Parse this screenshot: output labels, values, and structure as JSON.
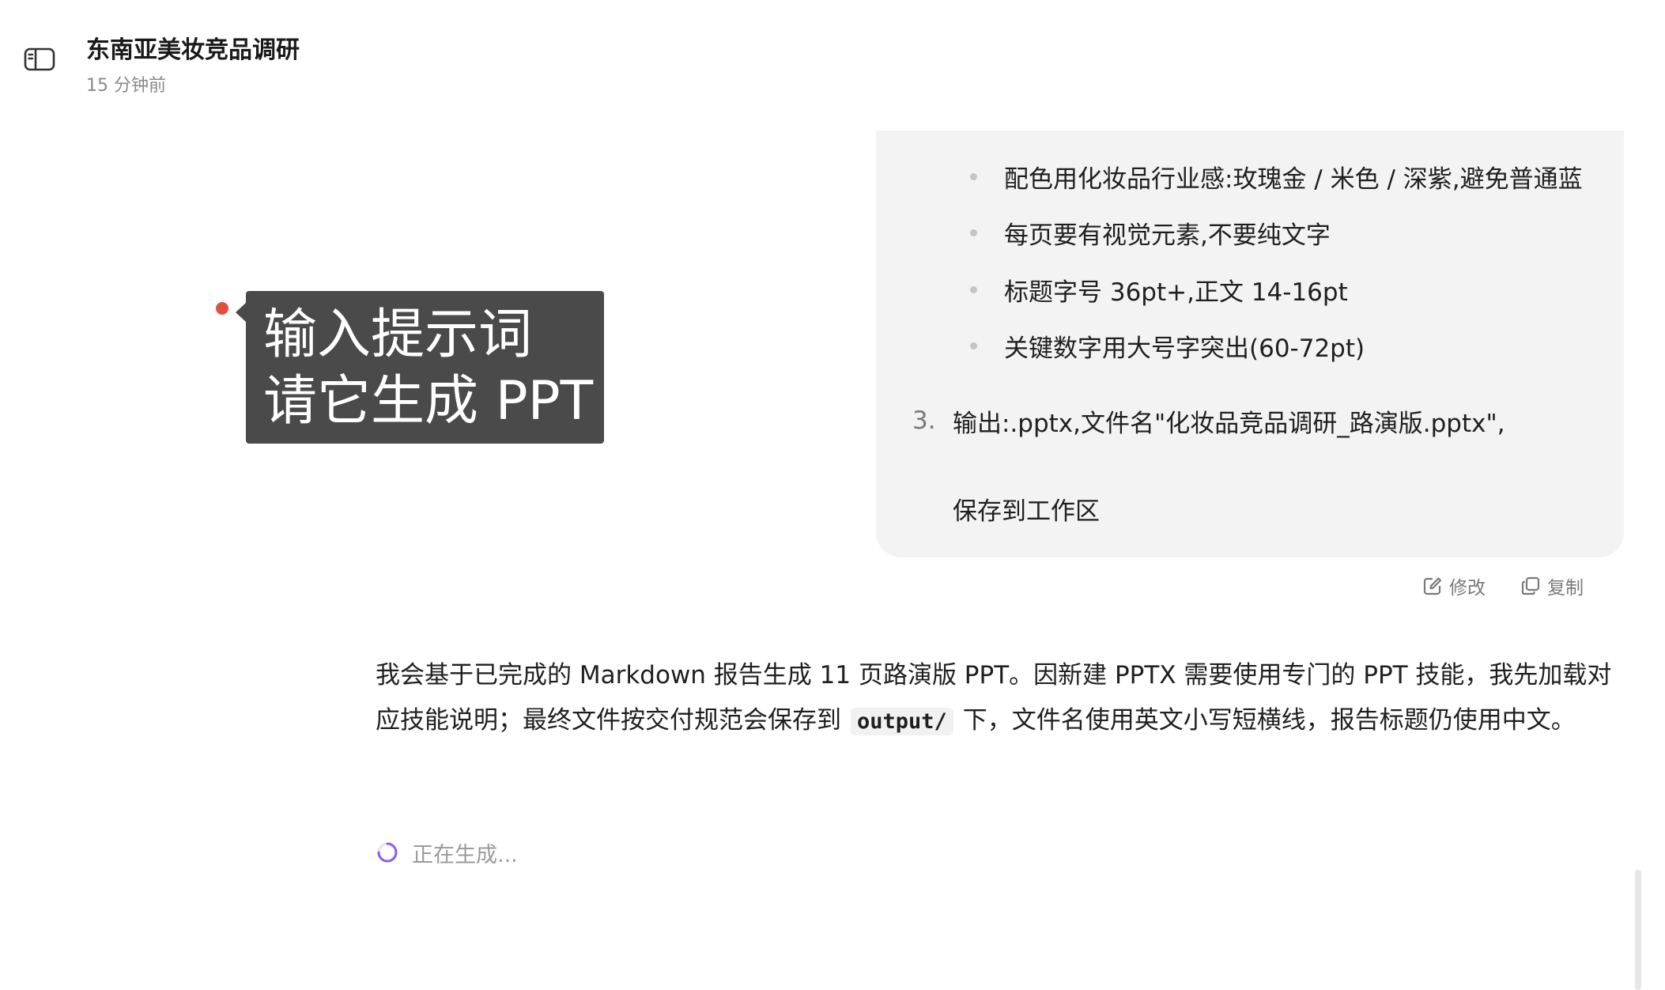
{
  "header": {
    "title": "东南亚美妆竞品调研",
    "time": "15 分钟前"
  },
  "user_message": {
    "bullets": [
      "配色用化妆品行业感:玫瑰金 / 米色 / 深紫,避免普通蓝",
      "每页要有视觉元素,不要纯文字",
      "标题字号 36pt+,正文 14-16pt",
      "关键数字用大号字突出(60-72pt)"
    ],
    "numbered_item": {
      "number": "3.",
      "line1": "输出:.pptx,文件名\"化妆品竞品调研_路演版.pptx\",",
      "line2": "保存到工作区"
    }
  },
  "actions": {
    "edit_label": "修改",
    "copy_label": "复制"
  },
  "assistant": {
    "part1": "我会基于已完成的 Markdown 报告生成 11 页路演版 PPT。因新建 PPTX 需要使用专门的 PPT 技能，我先加载对应技能说明；最终文件按交付规范会保存到",
    "code": "output/",
    "part2": "下，文件名使用英文小写短横线，报告标题仍使用中文。"
  },
  "status": {
    "generating": "正在生成..."
  },
  "tooltip": {
    "line1": "输入提示词",
    "line2": "请它生成 PPT"
  },
  "colors": {
    "spinner": "#8b5cf6",
    "tooltip_bg": "#4a4a4a",
    "annotation_dot": "#e0503f",
    "bubble_bg": "#f3f3f3"
  }
}
